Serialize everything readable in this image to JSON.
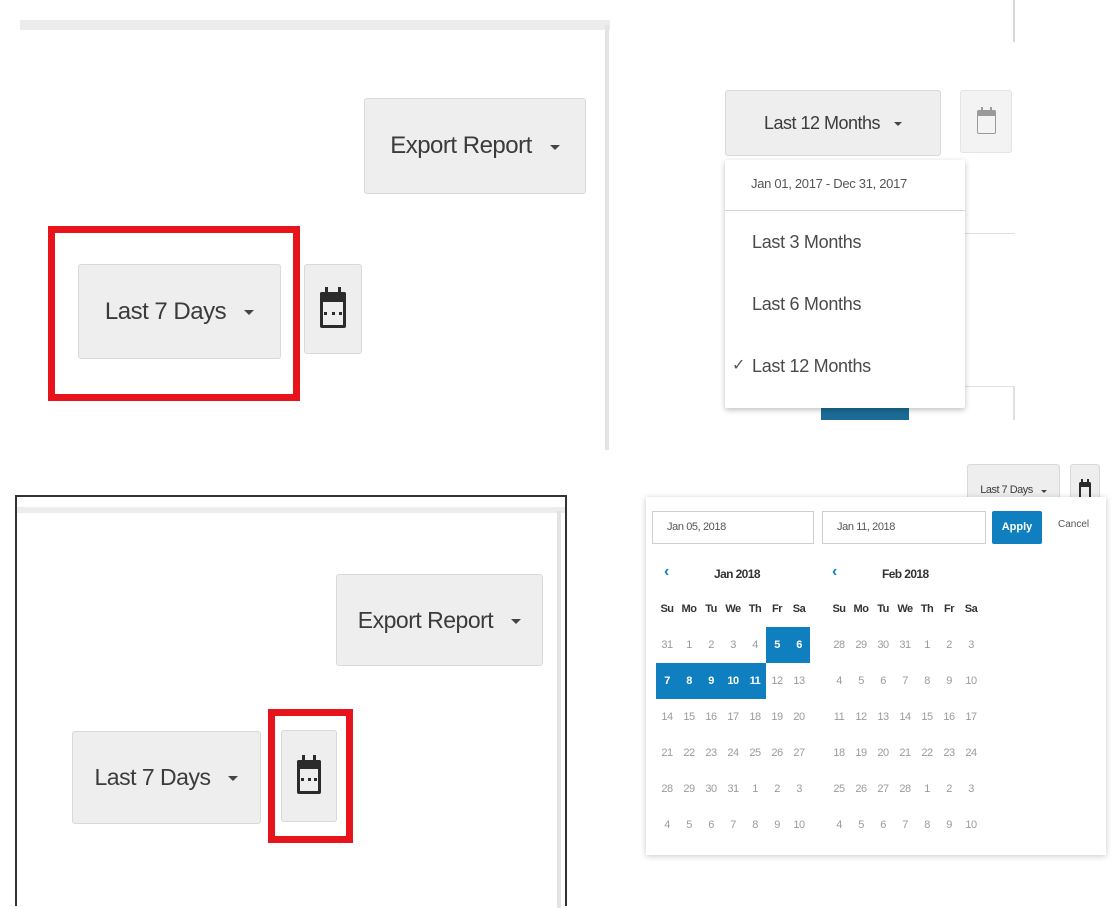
{
  "panel_a": {
    "export_label": "Export Report",
    "range_label": "Last 7 Days"
  },
  "panel_b": {
    "range_label": "Last 12 Months",
    "menu": {
      "range_text": "Jan 01, 2017 - Dec 31, 2017",
      "options": [
        {
          "label": "Last 3 Months",
          "checked": false
        },
        {
          "label": "Last 6 Months",
          "checked": false
        },
        {
          "label": "Last 12 Months",
          "checked": true
        }
      ],
      "check_glyph": "✓"
    }
  },
  "panel_c": {
    "export_label": "Export Report",
    "range_label": "Last 7 Days"
  },
  "panel_d": {
    "range_label": "Last 7 Days",
    "start_date": "Jan 05, 2018",
    "end_date": "Jan 11, 2018",
    "apply_label": "Apply",
    "cancel_label": "Cancel",
    "prev_glyph": "‹",
    "weekdays": [
      "Su",
      "Mo",
      "Tu",
      "We",
      "Th",
      "Fr",
      "Sa"
    ],
    "months": [
      {
        "title": "Jan 2018",
        "days": [
          "31",
          "1",
          "2",
          "3",
          "4",
          "5",
          "6",
          "7",
          "8",
          "9",
          "10",
          "11",
          "12",
          "13",
          "14",
          "15",
          "16",
          "17",
          "18",
          "19",
          "20",
          "21",
          "22",
          "23",
          "24",
          "25",
          "26",
          "27",
          "28",
          "29",
          "30",
          "31",
          "1",
          "2",
          "3",
          "4",
          "5",
          "6",
          "7",
          "8",
          "9",
          "10"
        ],
        "selected_idx": [
          5,
          6,
          7,
          8,
          9,
          10,
          11
        ]
      },
      {
        "title": "Feb 2018",
        "days": [
          "28",
          "29",
          "30",
          "31",
          "1",
          "2",
          "3",
          "4",
          "5",
          "6",
          "7",
          "8",
          "9",
          "10",
          "11",
          "12",
          "13",
          "14",
          "15",
          "16",
          "17",
          "18",
          "19",
          "20",
          "21",
          "22",
          "23",
          "24",
          "25",
          "26",
          "27",
          "28",
          "1",
          "2",
          "3",
          "4",
          "5",
          "6",
          "7",
          "8",
          "9",
          "10"
        ],
        "selected_idx": []
      }
    ]
  },
  "colors": {
    "highlight_red": "#e8141b",
    "accent_blue": "#0f7fbf",
    "button_gray": "#eeeeee"
  }
}
